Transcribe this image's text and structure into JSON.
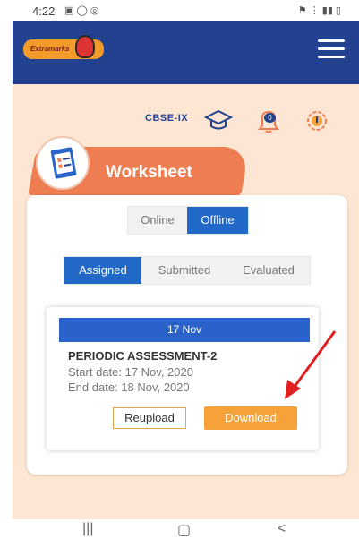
{
  "status_bar": {
    "time": "4:22"
  },
  "app": {
    "logo_text": "Extramarks"
  },
  "toolbar": {
    "board_label": "CBSE-IX",
    "notification_count": "0"
  },
  "section": {
    "title": "Worksheet"
  },
  "mode_tabs": [
    {
      "label": "Online",
      "active": false
    },
    {
      "label": "Offline",
      "active": true
    }
  ],
  "status_tabs": [
    {
      "label": "Assigned",
      "active": true
    },
    {
      "label": "Submitted",
      "active": false
    },
    {
      "label": "Evaluated",
      "active": false
    }
  ],
  "worksheet_item": {
    "date": "17 Nov",
    "title": "PERIODIC ASSESSMENT-2",
    "start": "Start date: 17 Nov, 2020",
    "end": "End date: 18 Nov, 2020",
    "reupload_label": "Reupload",
    "download_label": "Download"
  },
  "colors": {
    "header": "#22428f",
    "background": "#fde7d4",
    "accent_blue": "#2962c8",
    "banner": "#ef7d52",
    "download": "#f6a23a",
    "annotation_arrow": "#e02020"
  }
}
